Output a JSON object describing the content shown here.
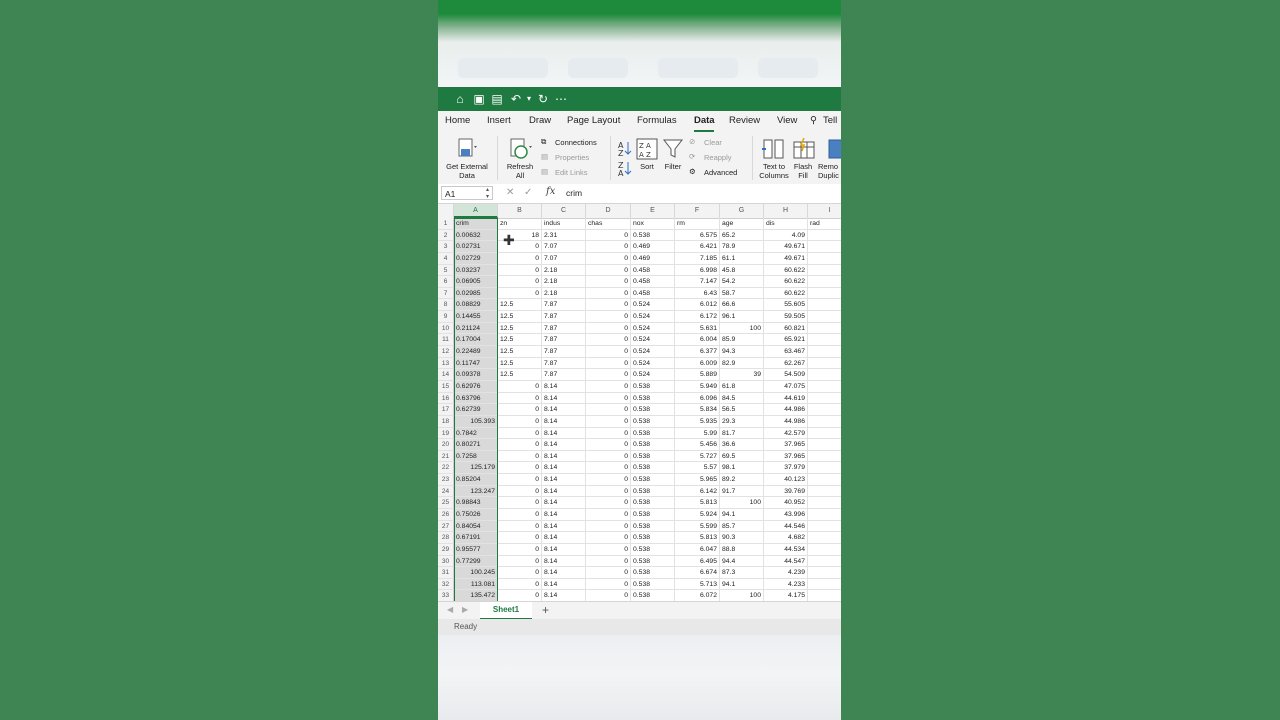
{
  "menu": [
    "Home",
    "Insert",
    "Draw",
    "Page Layout",
    "Formulas",
    "Data",
    "Review",
    "View",
    "Tell"
  ],
  "active_menu": "Data",
  "ribbon": {
    "get_external_data": "Get External Data",
    "refresh_all": "Refresh All",
    "connections": "Connections",
    "properties": "Properties",
    "edit_links": "Edit Links",
    "sort": "Sort",
    "filter": "Filter",
    "clear": "Clear",
    "reapply": "Reapply",
    "advanced": "Advanced",
    "text_to_columns": "Text to Columns",
    "flash_fill": "Flash Fill",
    "remove_duplicates": "Remo Duplic"
  },
  "formula_bar": {
    "name_box": "A1",
    "fx": "fx",
    "content": "crim"
  },
  "columns": [
    "A",
    "B",
    "C",
    "D",
    "E",
    "F",
    "G",
    "H",
    "I"
  ],
  "rows": [
    [
      1,
      "crim",
      "zn",
      "indus",
      "chas",
      "nox",
      "rm",
      "age",
      "dis",
      "rad"
    ],
    [
      2,
      "0.00632",
      "18",
      "2.31",
      "0",
      "0.538",
      "6.575",
      "65.2",
      "4.09",
      ""
    ],
    [
      3,
      "0.02731",
      "0",
      "7.07",
      "0",
      "0.469",
      "6.421",
      "78.9",
      "49.671",
      ""
    ],
    [
      4,
      "0.02729",
      "0",
      "7.07",
      "0",
      "0.469",
      "7.185",
      "61.1",
      "49.671",
      ""
    ],
    [
      5,
      "0.03237",
      "0",
      "2.18",
      "0",
      "0.458",
      "6.998",
      "45.8",
      "60.622",
      ""
    ],
    [
      6,
      "0.06905",
      "0",
      "2.18",
      "0",
      "0.458",
      "7.147",
      "54.2",
      "60.622",
      ""
    ],
    [
      7,
      "0.02985",
      "0",
      "2.18",
      "0",
      "0.458",
      "6.43",
      "58.7",
      "60.622",
      ""
    ],
    [
      8,
      "0.08829",
      "12.5",
      "7.87",
      "0",
      "0.524",
      "6.012",
      "66.6",
      "55.605",
      ""
    ],
    [
      9,
      "0.14455",
      "12.5",
      "7.87",
      "0",
      "0.524",
      "6.172",
      "96.1",
      "59.505",
      ""
    ],
    [
      10,
      "0.21124",
      "12.5",
      "7.87",
      "0",
      "0.524",
      "5.631",
      "100",
      "60.821",
      ""
    ],
    [
      11,
      "0.17004",
      "12.5",
      "7.87",
      "0",
      "0.524",
      "6.004",
      "85.9",
      "65.921",
      ""
    ],
    [
      12,
      "0.22489",
      "12.5",
      "7.87",
      "0",
      "0.524",
      "6.377",
      "94.3",
      "63.467",
      ""
    ],
    [
      13,
      "0.11747",
      "12.5",
      "7.87",
      "0",
      "0.524",
      "6.009",
      "82.9",
      "62.267",
      ""
    ],
    [
      14,
      "0.09378",
      "12.5",
      "7.87",
      "0",
      "0.524",
      "5.889",
      "39",
      "54.509",
      ""
    ],
    [
      15,
      "0.62976",
      "0",
      "8.14",
      "0",
      "0.538",
      "5.949",
      "61.8",
      "47.075",
      ""
    ],
    [
      16,
      "0.63796",
      "0",
      "8.14",
      "0",
      "0.538",
      "6.096",
      "84.5",
      "44.619",
      ""
    ],
    [
      17,
      "0.62739",
      "0",
      "8.14",
      "0",
      "0.538",
      "5.834",
      "56.5",
      "44.986",
      ""
    ],
    [
      18,
      "105.393",
      "0",
      "8.14",
      "0",
      "0.538",
      "5.935",
      "29.3",
      "44.986",
      ""
    ],
    [
      19,
      "0.7842",
      "0",
      "8.14",
      "0",
      "0.538",
      "5.99",
      "81.7",
      "42.579",
      ""
    ],
    [
      20,
      "0.80271",
      "0",
      "8.14",
      "0",
      "0.538",
      "5.456",
      "36.6",
      "37.965",
      ""
    ],
    [
      21,
      "0.7258",
      "0",
      "8.14",
      "0",
      "0.538",
      "5.727",
      "69.5",
      "37.965",
      ""
    ],
    [
      22,
      "125.179",
      "0",
      "8.14",
      "0",
      "0.538",
      "5.57",
      "98.1",
      "37.979",
      ""
    ],
    [
      23,
      "0.85204",
      "0",
      "8.14",
      "0",
      "0.538",
      "5.965",
      "89.2",
      "40.123",
      ""
    ],
    [
      24,
      "123.247",
      "0",
      "8.14",
      "0",
      "0.538",
      "6.142",
      "91.7",
      "39.769",
      ""
    ],
    [
      25,
      "0.98843",
      "0",
      "8.14",
      "0",
      "0.538",
      "5.813",
      "100",
      "40.952",
      ""
    ],
    [
      26,
      "0.75026",
      "0",
      "8.14",
      "0",
      "0.538",
      "5.924",
      "94.1",
      "43.996",
      ""
    ],
    [
      27,
      "0.84054",
      "0",
      "8.14",
      "0",
      "0.538",
      "5.599",
      "85.7",
      "44.546",
      ""
    ],
    [
      28,
      "0.67191",
      "0",
      "8.14",
      "0",
      "0.538",
      "5.813",
      "90.3",
      "4.682",
      ""
    ],
    [
      29,
      "0.95577",
      "0",
      "8.14",
      "0",
      "0.538",
      "6.047",
      "88.8",
      "44.534",
      ""
    ],
    [
      30,
      "0.77299",
      "0",
      "8.14",
      "0",
      "0.538",
      "6.495",
      "94.4",
      "44.547",
      ""
    ],
    [
      31,
      "100.245",
      "0",
      "8.14",
      "0",
      "0.538",
      "6.674",
      "87.3",
      "4.239",
      ""
    ],
    [
      32,
      "113.081",
      "0",
      "8.14",
      "0",
      "0.538",
      "5.713",
      "94.1",
      "4.233",
      ""
    ],
    [
      33,
      "135.472",
      "0",
      "8.14",
      "0",
      "0.538",
      "6.072",
      "100",
      "4.175",
      ""
    ]
  ],
  "text_cells": {
    "3": [
      "2.31",
      "4.09"
    ],
    "7": [
      "6.43"
    ],
    "19": [
      "5.99"
    ],
    "22": [
      "5.57"
    ]
  },
  "sheet_tab": "Sheet1",
  "add_sheet": "+",
  "status": "Ready",
  "colors": {
    "excel_green": "#1e7a40",
    "background": "#3f8553"
  }
}
